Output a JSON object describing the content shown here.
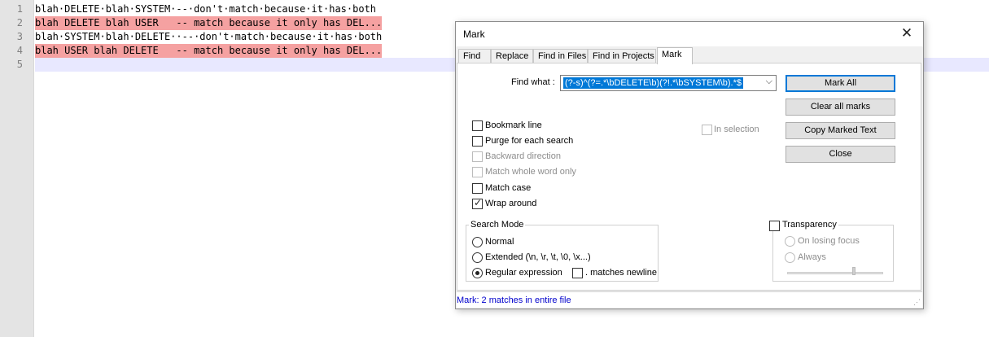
{
  "editor": {
    "line_numbers": [
      "1",
      "2",
      "3",
      "4",
      "5"
    ],
    "lines": [
      "blah·DELETE·blah·SYSTEM·--·don't·match·because·it·has·both",
      "blah DELETE blah USER   -- match because it only has DEL...",
      "blah·SYSTEM·blah·DELETE··--·don't·match·because·it·has·both",
      "blah USER blah DELETE   -- match because it only has DEL...",
      ""
    ],
    "marked_color": "#f5a1a1"
  },
  "dialog": {
    "title": "Mark",
    "close_glyph": "✕",
    "tabs": [
      "Find",
      "Replace",
      "Find in Files",
      "Find in Projects",
      "Mark"
    ],
    "active_tab": "Mark",
    "find_what_label": "Find what :",
    "find_what_value": "(?-s)^(?=.*\\bDELETE\\b)(?!.*\\bSYSTEM\\b).*$",
    "combo_arrow": "⌵",
    "buttons": {
      "mark_all": "Mark All",
      "clear_all_marks": "Clear all marks",
      "copy_marked_text": "Copy Marked Text",
      "close": "Close"
    },
    "options": {
      "bookmark_line": "Bookmark line",
      "purge_each_search": "Purge for each search",
      "backward_direction": "Backward direction",
      "match_whole_word": "Match whole word only",
      "match_case": "Match case",
      "wrap_around": "Wrap around",
      "in_selection": "In selection"
    },
    "search_mode": {
      "title": "Search Mode",
      "normal": "Normal",
      "extended": "Extended (\\n, \\r, \\t, \\0, \\x...)",
      "regex": "Regular expression",
      "matches_newline": ". matches newline"
    },
    "transparency": {
      "label": "Transparency",
      "on_losing_focus": "On losing focus",
      "always": "Always"
    },
    "status": "Mark: 2 matches in entire file",
    "check_glyph": "✓",
    "accent_color": "#0078d7",
    "status_color": "#0000cc"
  }
}
